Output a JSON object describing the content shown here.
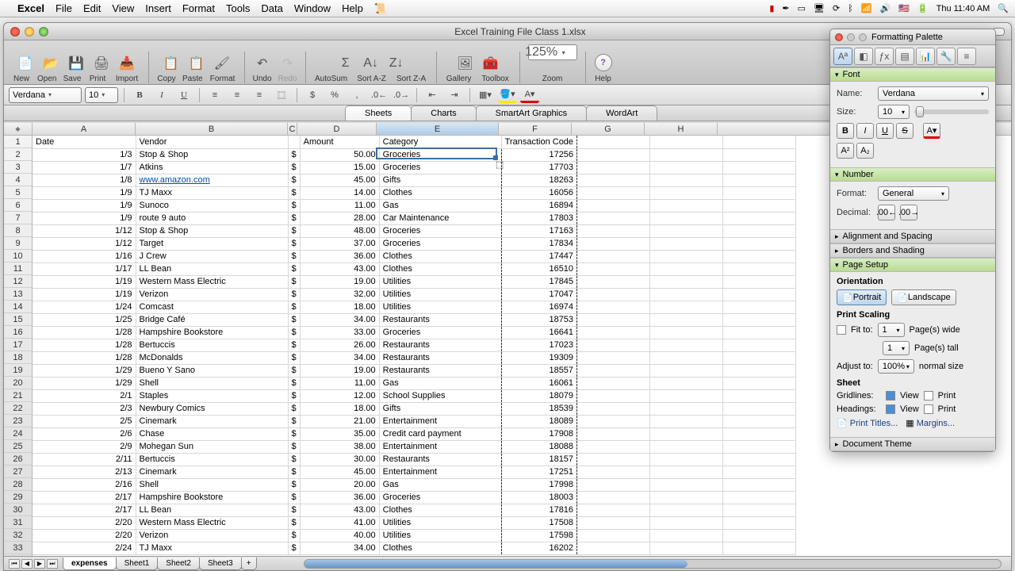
{
  "menubar": {
    "app": "Excel",
    "items": [
      "File",
      "Edit",
      "View",
      "Insert",
      "Format",
      "Tools",
      "Data",
      "Window",
      "Help"
    ],
    "clock": "Thu 11:40 AM"
  },
  "window": {
    "title": "Excel Training File Class 1.xlsx"
  },
  "toolbar": {
    "labels": {
      "new": "New",
      "open": "Open",
      "save": "Save",
      "print": "Print",
      "import": "Import",
      "copy": "Copy",
      "paste": "Paste",
      "format": "Format",
      "undo": "Undo",
      "redo": "Redo",
      "autosum": "AutoSum",
      "sortaz": "Sort A-Z",
      "sortza": "Sort Z-A",
      "gallery": "Gallery",
      "toolbox": "Toolbox",
      "zoom": "Zoom",
      "help": "Help"
    },
    "zoom": "125%"
  },
  "formatbar": {
    "font": "Verdana",
    "size": "10"
  },
  "ribbon": {
    "tabs": [
      "Sheets",
      "Charts",
      "SmartArt Graphics",
      "WordArt"
    ],
    "selected": 0
  },
  "columns": [
    "A",
    "B",
    "C",
    "D",
    "E",
    "F",
    "G",
    "H"
  ],
  "selected_col": "E",
  "headers": {
    "A": "Date",
    "B": "Vendor",
    "D": "Amount",
    "E": "Category",
    "F": "Transaction Code"
  },
  "rows": [
    {
      "r": 2,
      "date": "1/3",
      "vendor": "Stop & Shop",
      "amt": "50.00",
      "cat": "Groceries",
      "code": "17256"
    },
    {
      "r": 3,
      "date": "1/7",
      "vendor": "Atkins",
      "amt": "15.00",
      "cat": "Groceries",
      "code": "17703"
    },
    {
      "r": 4,
      "date": "1/8",
      "vendor": "www.amazon.com",
      "vlink": true,
      "amt": "45.00",
      "cat": "Gifts",
      "code": "18263"
    },
    {
      "r": 5,
      "date": "1/9",
      "vendor": "TJ Maxx",
      "amt": "14.00",
      "cat": "Clothes",
      "code": "16056"
    },
    {
      "r": 6,
      "date": "1/9",
      "vendor": "Sunoco",
      "amt": "11.00",
      "cat": "Gas",
      "code": "16894"
    },
    {
      "r": 7,
      "date": "1/9",
      "vendor": "route 9 auto",
      "amt": "28.00",
      "cat": "Car Maintenance",
      "code": "17803"
    },
    {
      "r": 8,
      "date": "1/12",
      "vendor": "Stop & Shop",
      "amt": "48.00",
      "cat": "Groceries",
      "code": "17163"
    },
    {
      "r": 9,
      "date": "1/12",
      "vendor": "Target",
      "amt": "37.00",
      "cat": "Groceries",
      "code": "17834"
    },
    {
      "r": 10,
      "date": "1/16",
      "vendor": "J Crew",
      "amt": "36.00",
      "cat": "Clothes",
      "code": "17447"
    },
    {
      "r": 11,
      "date": "1/17",
      "vendor": "LL Bean",
      "amt": "43.00",
      "cat": "Clothes",
      "code": "16510"
    },
    {
      "r": 12,
      "date": "1/19",
      "vendor": "Western Mass Electric",
      "amt": "19.00",
      "cat": "Utilities",
      "code": "17845"
    },
    {
      "r": 13,
      "date": "1/19",
      "vendor": "Verizon",
      "amt": "32.00",
      "cat": "Utilities",
      "code": "17047"
    },
    {
      "r": 14,
      "date": "1/24",
      "vendor": "Comcast",
      "amt": "18.00",
      "cat": "Utilities",
      "code": "16974"
    },
    {
      "r": 15,
      "date": "1/25",
      "vendor": "Bridge Café",
      "amt": "34.00",
      "cat": "Restaurants",
      "code": "18753"
    },
    {
      "r": 16,
      "date": "1/28",
      "vendor": "Hampshire Bookstore",
      "amt": "33.00",
      "cat": "Groceries",
      "code": "16641"
    },
    {
      "r": 17,
      "date": "1/28",
      "vendor": "Bertuccis",
      "amt": "26.00",
      "cat": "Restaurants",
      "code": "17023"
    },
    {
      "r": 18,
      "date": "1/28",
      "vendor": "McDonalds",
      "amt": "34.00",
      "cat": "Restaurants",
      "code": "19309"
    },
    {
      "r": 19,
      "date": "1/29",
      "vendor": "Bueno Y Sano",
      "amt": "19.00",
      "cat": "Restaurants",
      "code": "18557"
    },
    {
      "r": 20,
      "date": "1/29",
      "vendor": "Shell",
      "amt": "11.00",
      "cat": "Gas",
      "code": "16061"
    },
    {
      "r": 21,
      "date": "2/1",
      "vendor": "Staples",
      "amt": "12.00",
      "cat": "School Supplies",
      "code": "18079"
    },
    {
      "r": 22,
      "date": "2/3",
      "vendor": "Newbury Comics",
      "amt": "18.00",
      "cat": "Gifts",
      "code": "18539"
    },
    {
      "r": 23,
      "date": "2/5",
      "vendor": "Cinemark",
      "amt": "21.00",
      "cat": "Entertainment",
      "code": "18089"
    },
    {
      "r": 24,
      "date": "2/6",
      "vendor": "Chase",
      "amt": "35.00",
      "cat": "Credit card payment",
      "code": "17908"
    },
    {
      "r": 25,
      "date": "2/9",
      "vendor": "Mohegan Sun",
      "amt": "38.00",
      "cat": "Entertainment",
      "code": "18088"
    },
    {
      "r": 26,
      "date": "2/11",
      "vendor": "Bertuccis",
      "amt": "30.00",
      "cat": "Restaurants",
      "code": "18157"
    },
    {
      "r": 27,
      "date": "2/13",
      "vendor": "Cinemark",
      "amt": "45.00",
      "cat": "Entertainment",
      "code": "17251"
    },
    {
      "r": 28,
      "date": "2/16",
      "vendor": "Shell",
      "amt": "20.00",
      "cat": "Gas",
      "code": "17998"
    },
    {
      "r": 29,
      "date": "2/17",
      "vendor": "Hampshire Bookstore",
      "amt": "36.00",
      "cat": "Groceries",
      "code": "18003"
    },
    {
      "r": 30,
      "date": "2/17",
      "vendor": "LL Bean",
      "amt": "43.00",
      "cat": "Clothes",
      "code": "17816"
    },
    {
      "r": 31,
      "date": "2/20",
      "vendor": "Western Mass Electric",
      "amt": "41.00",
      "cat": "Utilities",
      "code": "17508"
    },
    {
      "r": 32,
      "date": "2/20",
      "vendor": "Verizon",
      "amt": "40.00",
      "cat": "Utilities",
      "code": "17598"
    },
    {
      "r": 33,
      "date": "2/24",
      "vendor": "TJ Maxx",
      "amt": "34.00",
      "cat": "Clothes",
      "code": "16202"
    }
  ],
  "sheettabs": {
    "tabs": [
      "expenses",
      "Sheet1",
      "Sheet2",
      "Sheet3"
    ],
    "selected": 0
  },
  "palette": {
    "title": "Formatting Palette",
    "font": {
      "section": "Font",
      "name_lbl": "Name:",
      "name": "Verdana",
      "size_lbl": "Size:",
      "size": "10"
    },
    "number": {
      "section": "Number",
      "format_lbl": "Format:",
      "format": "General",
      "decimal_lbl": "Decimal:"
    },
    "align": {
      "section": "Alignment and Spacing"
    },
    "borders": {
      "section": "Borders and Shading"
    },
    "page": {
      "section": "Page Setup",
      "orientation_lbl": "Orientation",
      "portrait": "Portrait",
      "landscape": "Landscape",
      "scaling_lbl": "Print Scaling",
      "fitto": "Fit to:",
      "pages_wide": "Page(s) wide",
      "pages_tall": "Page(s) tall",
      "adjust": "Adjust to:",
      "pct": "100%",
      "normal": "normal size",
      "sheet_lbl": "Sheet",
      "gridlines": "Gridlines:",
      "headings": "Headings:",
      "view": "View",
      "print": "Print",
      "print_titles": "Print Titles...",
      "margins": "Margins...",
      "fit_w": "1",
      "fit_h": "1"
    },
    "theme": {
      "section": "Document Theme"
    }
  },
  "chart_data": null
}
